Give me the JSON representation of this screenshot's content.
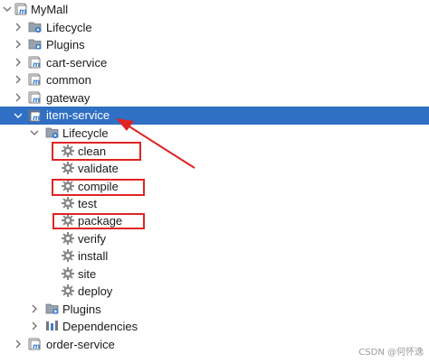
{
  "tree": {
    "root": {
      "label": "MyMall",
      "icon": "maven-module-icon"
    },
    "nodes": [
      {
        "id": "lifecycle-top",
        "label": "Lifecycle",
        "icon": "lifecycle-folder-icon"
      },
      {
        "id": "plugins-top",
        "label": "Plugins",
        "icon": "plugins-folder-icon"
      },
      {
        "id": "cart-service",
        "label": "cart-service",
        "icon": "maven-module-icon"
      },
      {
        "id": "common",
        "label": "common",
        "icon": "maven-module-icon"
      },
      {
        "id": "gateway",
        "label": "gateway",
        "icon": "maven-module-icon"
      },
      {
        "id": "item-service",
        "label": "item-service",
        "icon": "maven-module-icon",
        "selected": true
      },
      {
        "id": "item-lifecycle",
        "label": "Lifecycle",
        "icon": "lifecycle-folder-icon"
      },
      {
        "id": "goal-clean",
        "label": "clean",
        "icon": "gear-icon",
        "highlighted": true
      },
      {
        "id": "goal-validate",
        "label": "validate",
        "icon": "gear-icon"
      },
      {
        "id": "goal-compile",
        "label": "compile",
        "icon": "gear-icon",
        "highlighted": true
      },
      {
        "id": "goal-test",
        "label": "test",
        "icon": "gear-icon"
      },
      {
        "id": "goal-package",
        "label": "package",
        "icon": "gear-icon",
        "highlighted": true
      },
      {
        "id": "goal-verify",
        "label": "verify",
        "icon": "gear-icon"
      },
      {
        "id": "goal-install",
        "label": "install",
        "icon": "gear-icon"
      },
      {
        "id": "goal-site",
        "label": "site",
        "icon": "gear-icon"
      },
      {
        "id": "goal-deploy",
        "label": "deploy",
        "icon": "gear-icon"
      },
      {
        "id": "item-plugins",
        "label": "Plugins",
        "icon": "plugins-folder-icon"
      },
      {
        "id": "item-dependencies",
        "label": "Dependencies",
        "icon": "dependencies-icon"
      },
      {
        "id": "order-service",
        "label": "order-service",
        "icon": "maven-module-icon"
      }
    ]
  },
  "colors": {
    "selection": "#2f6fc4",
    "highlight": "#e02424",
    "maven_icon": "#3d7fcf",
    "gear_icon": "#8a8a8a"
  },
  "watermark": "CSDN @何怀逸"
}
